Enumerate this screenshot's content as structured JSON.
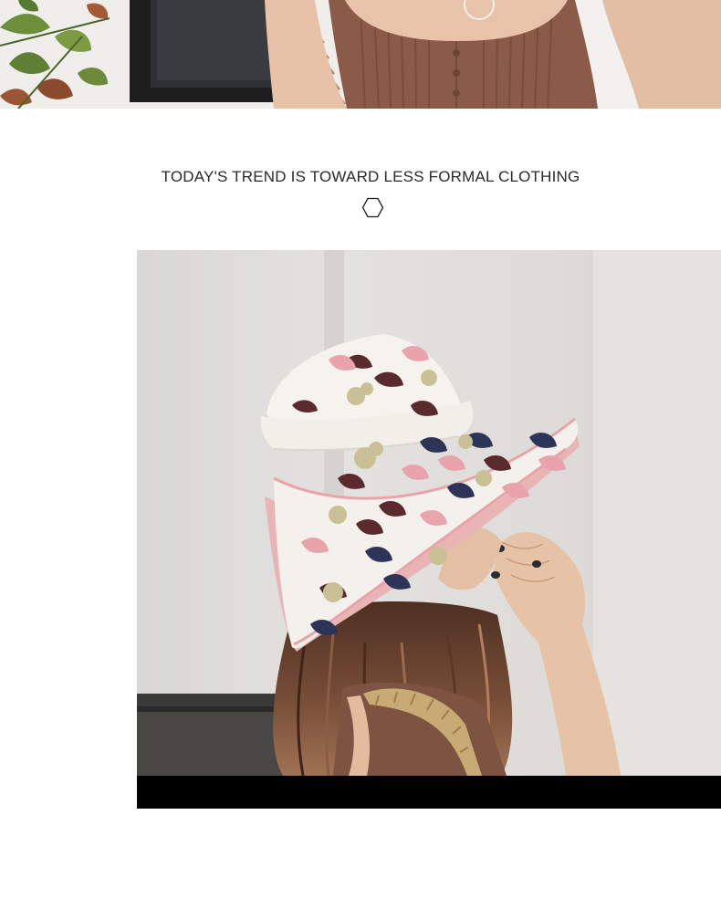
{
  "caption": {
    "text": "TODAY'S TREND IS TOWARD LESS FORMAL CLOTHING",
    "ornament_icon": "hexagon-outline-icon"
  },
  "photos": {
    "top": {
      "subject": "woman in brown ribbed button-front knit top with woven straw bag strap and plant"
    },
    "main": {
      "subject": "woman in profile wearing a wide-brim bucket hat with pink, navy, maroon and olive leaf print, long brown hair, straw bag strap"
    }
  },
  "colors": {
    "background": "#ffffff",
    "caption_text": "#2a2a2a",
    "knit_top": "#8a5b48",
    "hat_base": "#f4f1ec",
    "hat_pink": "#e9a3ad",
    "hat_navy": "#2e3457",
    "hat_maroon": "#5a2a2e",
    "hat_olive": "#c9c095",
    "hair": "#6e4632",
    "wall": "#dedcd8",
    "bottom_bar": "#000000"
  }
}
